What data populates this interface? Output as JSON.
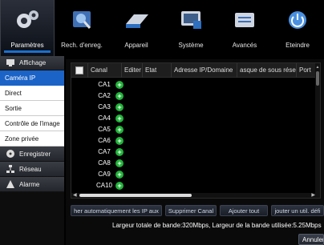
{
  "topnav": {
    "items": [
      {
        "label": "Paramètres",
        "icon": "gears-icon",
        "active": true
      },
      {
        "label": "Rech. d'enreg.",
        "icon": "search-icon"
      },
      {
        "label": "Appareil",
        "icon": "hard-drive-icon"
      },
      {
        "label": "Système",
        "icon": "monitor-icon"
      },
      {
        "label": "Avancés",
        "icon": "advanced-icon"
      },
      {
        "label": "Eteindre",
        "icon": "power-icon"
      }
    ]
  },
  "sidebar": {
    "affichage": "Affichage",
    "sub": [
      "Caméra IP",
      "Direct",
      "Sortie",
      "Contrôle de l'image",
      "Zone privée"
    ],
    "groups": [
      "Enregistrer",
      "Réseau",
      "Alarme"
    ]
  },
  "table": {
    "headers": [
      "Canal",
      "Editer",
      "Etat",
      "Adresse IP/Domaine",
      "asque de sous résea",
      "Port"
    ],
    "rows": [
      "CA1",
      "CA2",
      "CA3",
      "CA4",
      "CA5",
      "CA6",
      "CA7",
      "CA8",
      "CA9",
      "CA10"
    ]
  },
  "buttons": {
    "auto_add": "her automatiquement les IP aux",
    "delete_channel": "Supprimer Canal",
    "add_all": "Ajouter tout",
    "add_user": "jouter un util. défi"
  },
  "bandwidth": "Largeur totale de bande:320Mbps,  Largeur de la bande utilisée:5.25Mbps",
  "cancel": "Annuler",
  "colors": {
    "accent": "#1b63c7",
    "ok": "#21b33a"
  }
}
